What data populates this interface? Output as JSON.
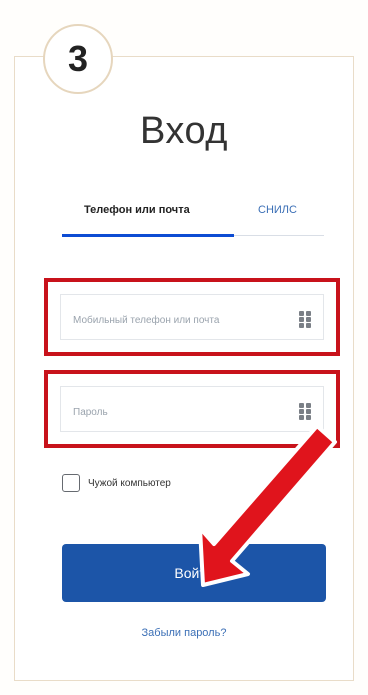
{
  "step_number": "3",
  "title": "Вход",
  "tabs": {
    "active_label": "Телефон или почта",
    "inactive_label": "СНИЛС"
  },
  "fields": {
    "login_placeholder": "Мобильный телефон или почта",
    "password_placeholder": "Пароль"
  },
  "checkbox": {
    "label": "Чужой компьютер",
    "checked": false
  },
  "buttons": {
    "login_label": "Войти",
    "forgot_label": "Забыли пароль?"
  },
  "colors": {
    "highlight_red": "#c8121b",
    "primary_blue": "#1c55a8",
    "link_blue": "#3b6fb6",
    "arrow_red": "#e0141c"
  }
}
